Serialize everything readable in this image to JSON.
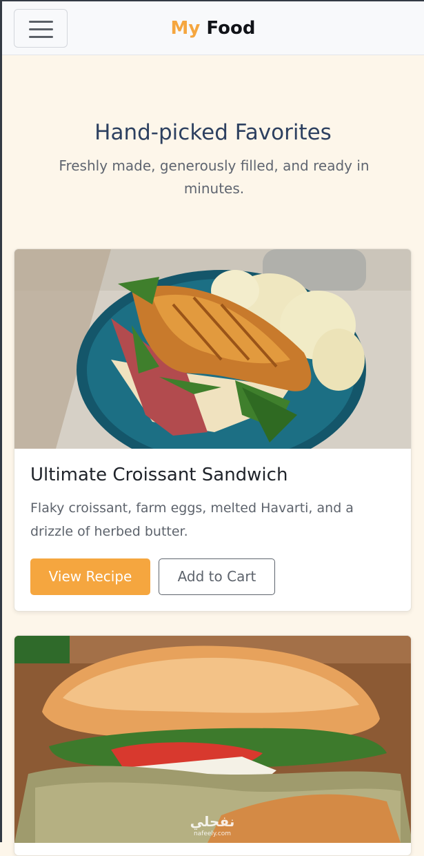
{
  "navbar": {
    "brand_part1": "My",
    "brand_part2": "Food",
    "menu_icon": "hamburger-menu-icon"
  },
  "section": {
    "title": "Hand-picked Favorites",
    "subtitle": "Freshly made, generously filled, and ready in minutes."
  },
  "cards": [
    {
      "title": "Ultimate Croissant Sandwich",
      "description": "Flaky croissant, farm eggs, melted Havarti, and a drizzle of herbed butter.",
      "primary_label": "View Recipe",
      "secondary_label": "Add to Cart"
    },
    {
      "image": "pesto-chicken-ciabatta-sandwich"
    }
  ],
  "watermark": {
    "line1": "نفحلي",
    "line2": "nafeely.com"
  },
  "colors": {
    "accent": "#f5a63f",
    "background": "#fdf6ea",
    "heading": "#2d4060"
  }
}
